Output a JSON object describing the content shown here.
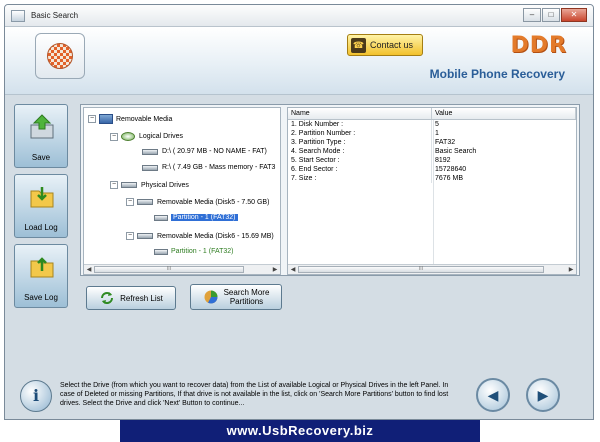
{
  "window": {
    "title": "Basic Search",
    "controls": {
      "minimize": "–",
      "maximize": "□",
      "close": "✕"
    }
  },
  "banner": {
    "contact_label": "Contact us",
    "brand": "DDR",
    "product": "Mobile Phone Recovery"
  },
  "sidebar": {
    "save": "Save",
    "load_log": "Load Log",
    "save_log": "Save Log"
  },
  "tree": {
    "root": "Removable Media",
    "logical_drives": "Logical Drives",
    "drive_d": "D:\\ ( 20.97 MB - NO NAME - FAT)",
    "drive_r": "R:\\ ( 7.49 GB - Mass memory - FAT3",
    "physical_drives": "Physical Drives",
    "disk5": "Removable Media (Disk5 - 7.50 GB)",
    "disk5_partition": "Partition - 1 (FAT32)",
    "disk6": "Removable Media (Disk6 - 15.69 MB)",
    "disk6_partition": "Partition - 1 (FAT32)",
    "scroll_grip": "III"
  },
  "details": {
    "headers": {
      "name": "Name",
      "value": "Value"
    },
    "rows": [
      {
        "name": "1. Disk Number :",
        "value": "5"
      },
      {
        "name": "2. Partition Number :",
        "value": "1"
      },
      {
        "name": "3. Partition Type :",
        "value": "FAT32"
      },
      {
        "name": "4. Search Mode :",
        "value": "Basic Search"
      },
      {
        "name": "5. Start Sector :",
        "value": "8192"
      },
      {
        "name": "6. End Sector :",
        "value": "15728640"
      },
      {
        "name": "7. Size :",
        "value": "7676 MB"
      }
    ],
    "scroll_grip": "III"
  },
  "actions": {
    "refresh": "Refresh List",
    "search_more_line1": "Search More",
    "search_more_line2": "Partitions"
  },
  "footer": {
    "info_glyph": "i",
    "text": "Select the Drive (from which you want to recover data) from the List of available Logical or Physical Drives in the left Panel. In case of Deleted or missing Partitions, If that drive is not available in the list, click on 'Search More Partitions' button to find lost drives. Select the Drive and click 'Next' Button to continue...",
    "back_glyph": "◀",
    "next_glyph": "▶"
  },
  "url": "www.UsbRecovery.biz",
  "colors": {
    "brand": "#e37a2a",
    "product": "#2a5d98",
    "selection": "#2f6fd6",
    "url_bar": "#101f77",
    "partition_text": "#2f7d22"
  }
}
